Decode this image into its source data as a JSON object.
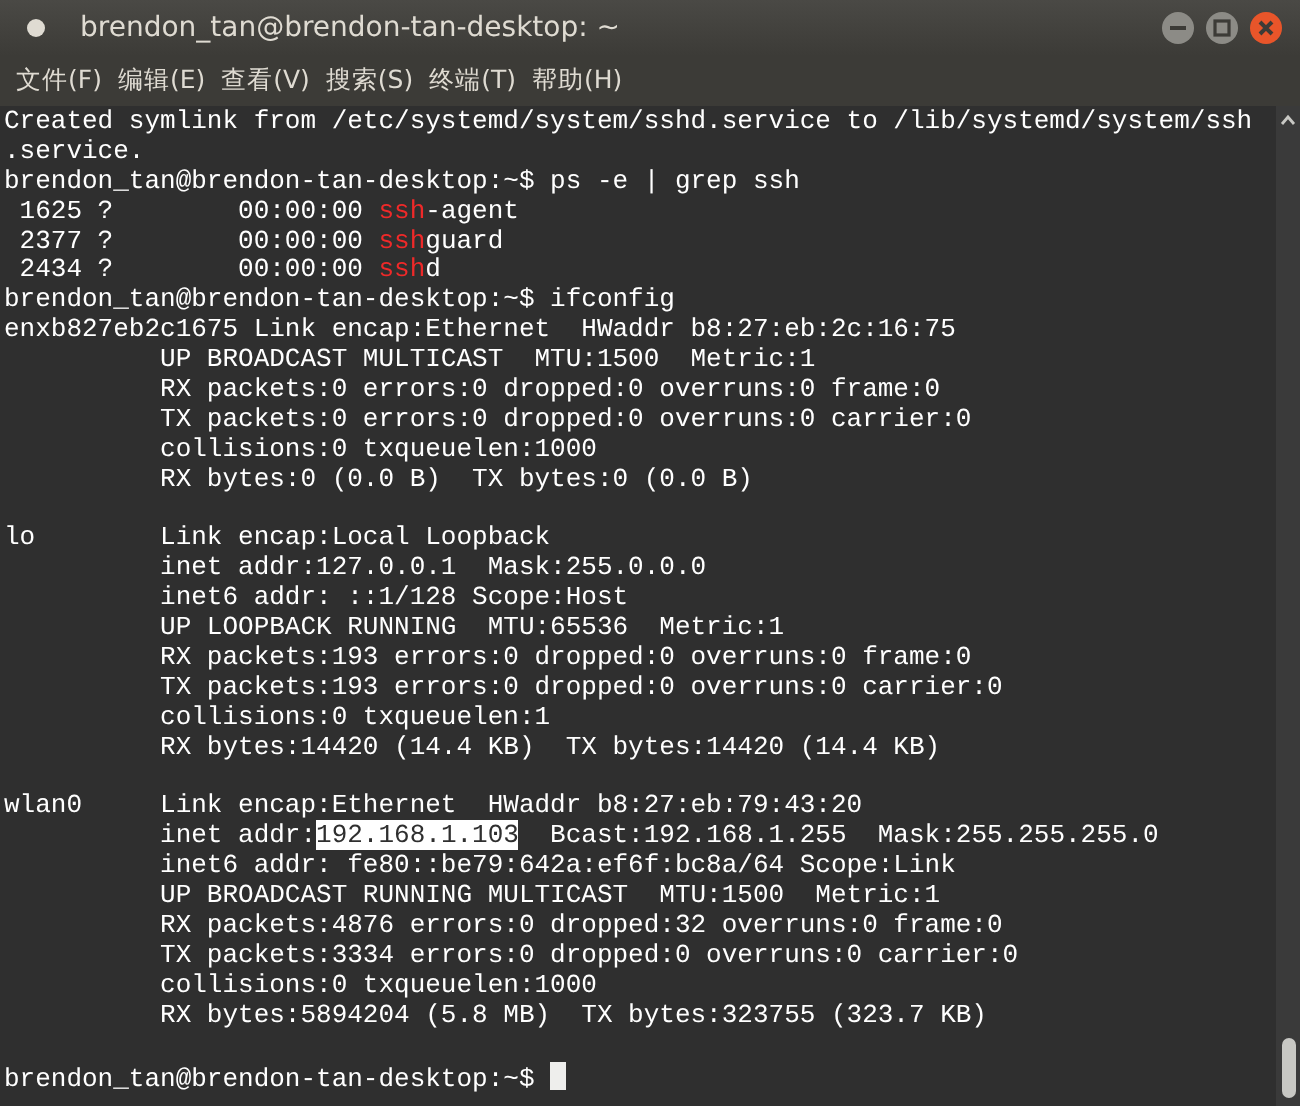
{
  "window": {
    "title": "brendon_tan@brendon-tan-desktop: ~"
  },
  "menu": [
    {
      "label": "文件(F)"
    },
    {
      "label": "编辑(E)"
    },
    {
      "label": "查看(V)"
    },
    {
      "label": "搜索(S)"
    },
    {
      "label": "终端(T)"
    },
    {
      "label": "帮助(H)"
    }
  ],
  "terminal": {
    "lines": [
      {
        "kind": "text",
        "segments": [
          {
            "kind": "plain",
            "text": "Created symlink from /etc/systemd/system/sshd.service to /lib/systemd/system/ssh"
          }
        ]
      },
      {
        "kind": "text",
        "segments": [
          {
            "kind": "plain",
            "text": ".service."
          }
        ]
      },
      {
        "kind": "text",
        "segments": [
          {
            "kind": "plain",
            "text": "brendon_tan@brendon-tan-desktop:~$ ps -e | grep ssh"
          }
        ]
      },
      {
        "kind": "text",
        "segments": [
          {
            "kind": "plain",
            "text": " 1625 ?        00:00:00 "
          },
          {
            "kind": "match",
            "text": "ssh"
          },
          {
            "kind": "plain",
            "text": "-agent"
          }
        ]
      },
      {
        "kind": "text",
        "segments": [
          {
            "kind": "plain",
            "text": " 2377 ?        00:00:00 "
          },
          {
            "kind": "match",
            "text": "ssh"
          },
          {
            "kind": "plain",
            "text": "guard"
          }
        ]
      },
      {
        "kind": "text",
        "segments": [
          {
            "kind": "plain",
            "text": " 2434 ?        00:00:00 "
          },
          {
            "kind": "match",
            "text": "ssh"
          },
          {
            "kind": "plain",
            "text": "d"
          }
        ]
      },
      {
        "kind": "text",
        "segments": [
          {
            "kind": "plain",
            "text": "brendon_tan@brendon-tan-desktop:~$ ifconfig"
          }
        ]
      },
      {
        "kind": "text",
        "segments": [
          {
            "kind": "plain",
            "text": "enxb827eb2c1675 Link encap:Ethernet  HWaddr b8:27:eb:2c:16:75"
          }
        ]
      },
      {
        "kind": "text",
        "segments": [
          {
            "kind": "plain",
            "text": "          UP BROADCAST MULTICAST  MTU:1500  Metric:1"
          }
        ]
      },
      {
        "kind": "text",
        "segments": [
          {
            "kind": "plain",
            "text": "          RX packets:0 errors:0 dropped:0 overruns:0 frame:0"
          }
        ]
      },
      {
        "kind": "text",
        "segments": [
          {
            "kind": "plain",
            "text": "          TX packets:0 errors:0 dropped:0 overruns:0 carrier:0"
          }
        ]
      },
      {
        "kind": "text",
        "segments": [
          {
            "kind": "plain",
            "text": "          collisions:0 txqueuelen:1000"
          }
        ]
      },
      {
        "kind": "text",
        "segments": [
          {
            "kind": "plain",
            "text": "          RX bytes:0 (0.0 B)  TX bytes:0 (0.0 B)"
          }
        ]
      },
      {
        "kind": "blank"
      },
      {
        "kind": "text",
        "segments": [
          {
            "kind": "plain",
            "text": "lo        Link encap:Local Loopback"
          }
        ]
      },
      {
        "kind": "text",
        "segments": [
          {
            "kind": "plain",
            "text": "          inet addr:127.0.0.1  Mask:255.0.0.0"
          }
        ]
      },
      {
        "kind": "text",
        "segments": [
          {
            "kind": "plain",
            "text": "          inet6 addr: ::1/128 Scope:Host"
          }
        ]
      },
      {
        "kind": "text",
        "segments": [
          {
            "kind": "plain",
            "text": "          UP LOOPBACK RUNNING  MTU:65536  Metric:1"
          }
        ]
      },
      {
        "kind": "text",
        "segments": [
          {
            "kind": "plain",
            "text": "          RX packets:193 errors:0 dropped:0 overruns:0 frame:0"
          }
        ]
      },
      {
        "kind": "text",
        "segments": [
          {
            "kind": "plain",
            "text": "          TX packets:193 errors:0 dropped:0 overruns:0 carrier:0"
          }
        ]
      },
      {
        "kind": "text",
        "segments": [
          {
            "kind": "plain",
            "text": "          collisions:0 txqueuelen:1"
          }
        ]
      },
      {
        "kind": "text",
        "segments": [
          {
            "kind": "plain",
            "text": "          RX bytes:14420 (14.4 KB)  TX bytes:14420 (14.4 KB)"
          }
        ]
      },
      {
        "kind": "blank"
      },
      {
        "kind": "text",
        "segments": [
          {
            "kind": "plain",
            "text": "wlan0     Link encap:Ethernet  HWaddr b8:27:eb:79:43:20"
          }
        ]
      },
      {
        "kind": "text",
        "segments": [
          {
            "kind": "plain",
            "text": "          inet addr:"
          },
          {
            "kind": "selection",
            "text": "192.168.1.103"
          },
          {
            "kind": "plain",
            "text": "  Bcast:192.168.1.255  Mask:255.255.255.0"
          }
        ]
      },
      {
        "kind": "text",
        "segments": [
          {
            "kind": "plain",
            "text": "          inet6 addr: fe80::be79:642a:ef6f:bc8a/64 Scope:Link"
          }
        ]
      },
      {
        "kind": "text",
        "segments": [
          {
            "kind": "plain",
            "text": "          UP BROADCAST RUNNING MULTICAST  MTU:1500  Metric:1"
          }
        ]
      },
      {
        "kind": "text",
        "segments": [
          {
            "kind": "plain",
            "text": "          RX packets:4876 errors:0 dropped:32 overruns:0 frame:0"
          }
        ]
      },
      {
        "kind": "text",
        "segments": [
          {
            "kind": "plain",
            "text": "          TX packets:3334 errors:0 dropped:0 overruns:0 carrier:0"
          }
        ]
      },
      {
        "kind": "text",
        "segments": [
          {
            "kind": "plain",
            "text": "          collisions:0 txqueuelen:1000"
          }
        ]
      },
      {
        "kind": "text",
        "segments": [
          {
            "kind": "plain",
            "text": "          RX bytes:5894204 (5.8 MB)  TX bytes:323755 (323.7 KB)"
          }
        ]
      },
      {
        "kind": "blank"
      },
      {
        "kind": "text",
        "segments": [
          {
            "kind": "plain",
            "text": "brendon_tan@brendon-tan-desktop:~$ "
          },
          {
            "kind": "cursor"
          }
        ]
      }
    ]
  }
}
